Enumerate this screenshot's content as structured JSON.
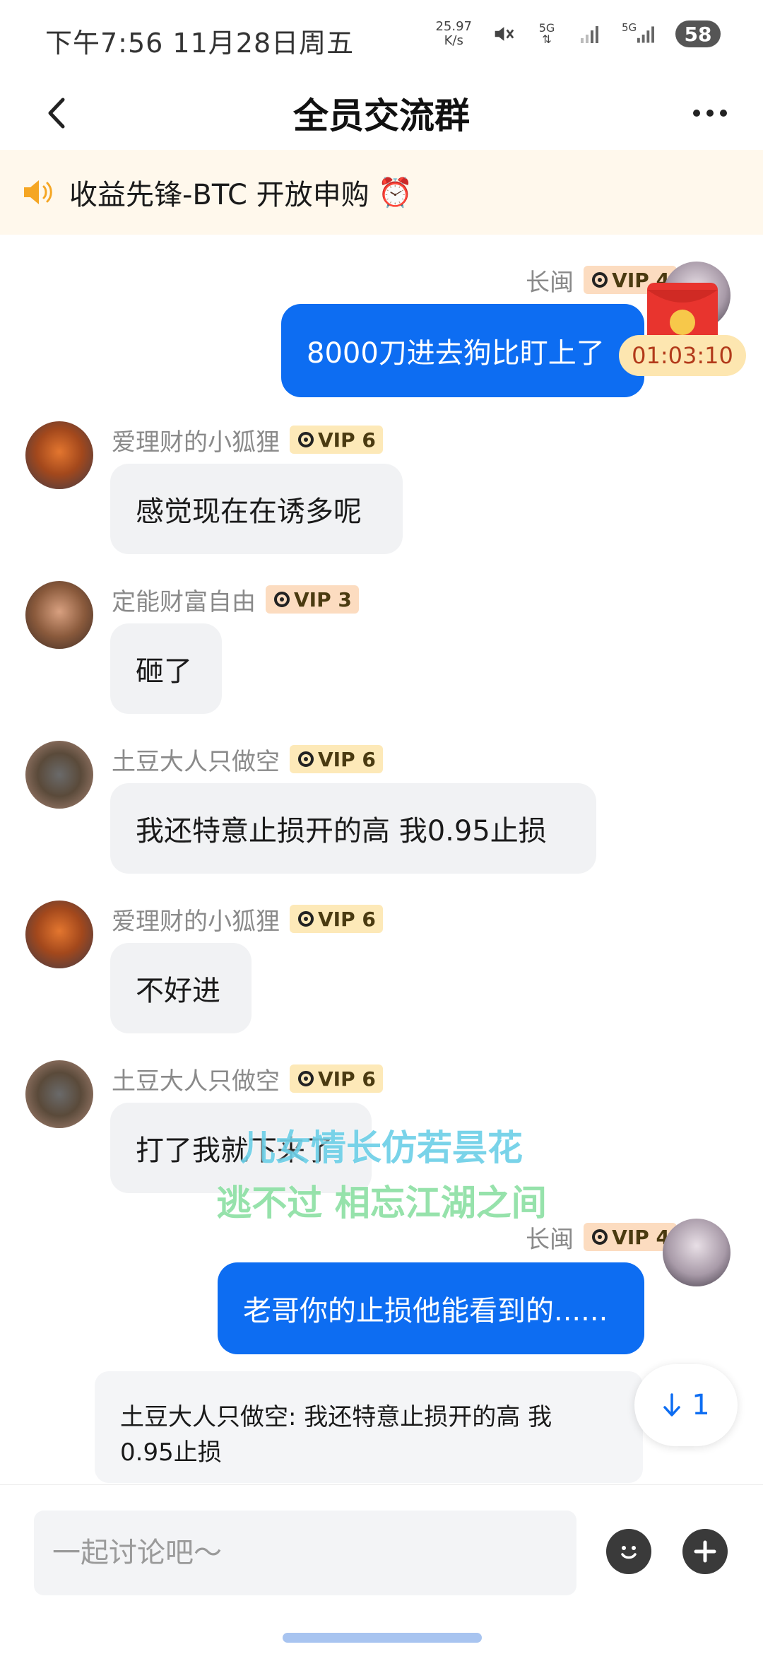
{
  "status_bar": {
    "time": "下午7:56  11月28日周五",
    "net_speed_value": "25.97",
    "net_speed_unit": "K/s",
    "signal1": "5G",
    "signal2": "5G",
    "battery": "58"
  },
  "header": {
    "title": "全员交流群",
    "back_icon": "chevron-left-icon",
    "more_icon": "more-dots-icon"
  },
  "announcement": {
    "text": "收益先锋-BTC 开放申购",
    "emoji": "⏰",
    "icon": "speaker-icon"
  },
  "red_packet": {
    "timer": "01:03:10"
  },
  "messages": [
    {
      "side": "right",
      "name": "长闽",
      "vip": "VIP 4",
      "text": "8000刀进去狗比盯上了"
    },
    {
      "side": "left",
      "name": "爱理财的小狐狸",
      "vip": "VIP 6",
      "text": "感觉现在在诱多呢"
    },
    {
      "side": "left",
      "name": "定能财富自由",
      "vip": "VIP 3",
      "text": "砸了"
    },
    {
      "side": "left",
      "name": "土豆大人只做空",
      "vip": "VIP 6",
      "text": "我还特意止损开的高  我0.95止损"
    },
    {
      "side": "left",
      "name": "爱理财的小狐狸",
      "vip": "VIP 6",
      "text": "不好进"
    },
    {
      "side": "left",
      "name": "土豆大人只做空",
      "vip": "VIP 6",
      "text": "打了我就下来了"
    },
    {
      "side": "right",
      "name": "长闽",
      "vip": "VIP 4",
      "text": "老哥你的止损他能看到的......"
    }
  ],
  "overlay": {
    "line1": "儿女情长仿若昙花",
    "line2": "逃不过 相忘江湖之间"
  },
  "quote": {
    "line1": "土豆大人只做空: 我还特意止损开的高  我",
    "line2": "0.95止损"
  },
  "scroll_down": {
    "count": "1"
  },
  "input": {
    "placeholder": "一起讨论吧～"
  },
  "colors": {
    "accent": "#0d6df2",
    "bubble_left": "#f1f2f4",
    "announcement_bg": "#fff8ec",
    "vip_bg": "#fde9b8"
  }
}
